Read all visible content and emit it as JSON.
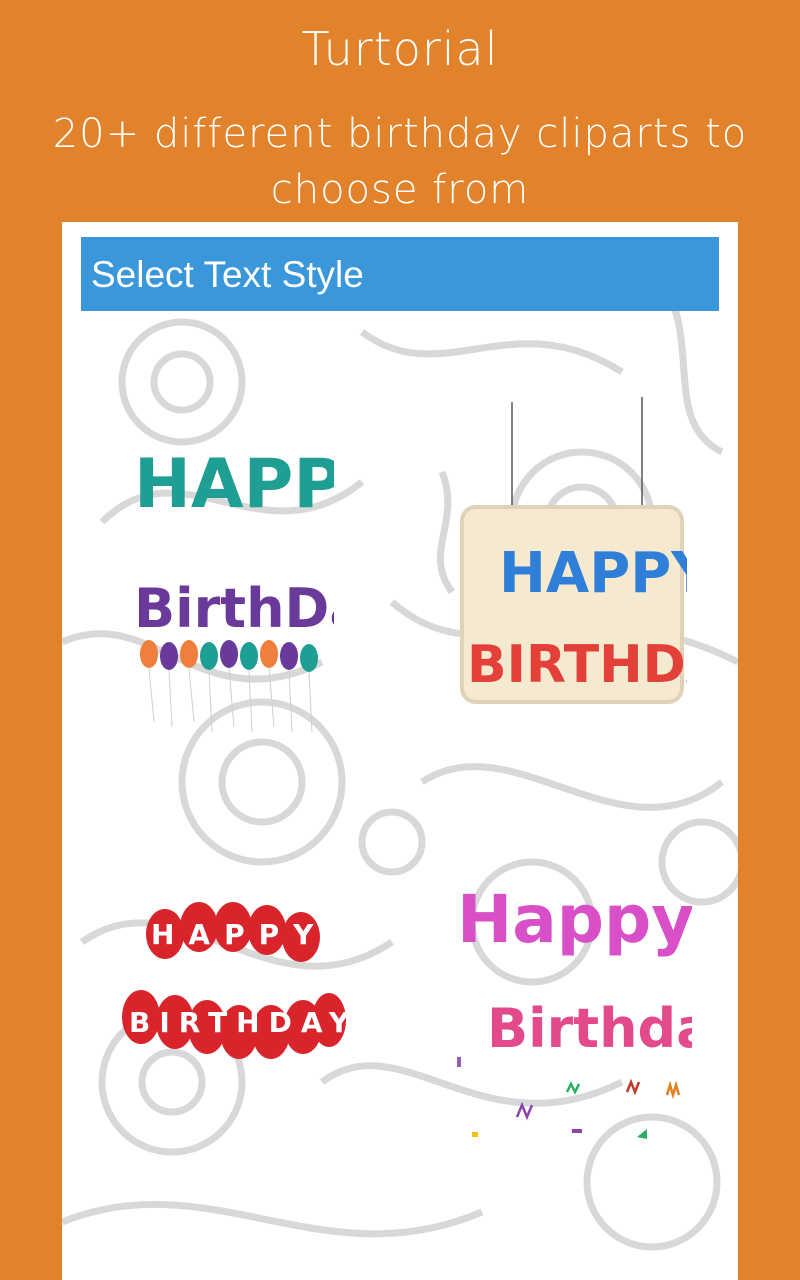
{
  "header": {
    "title": "Turtorial",
    "subtitle": "20+ different birthday cliparts  to choose from"
  },
  "dialog": {
    "title": "Select Text Style"
  },
  "cliparts": [
    {
      "line1": "HAPPY",
      "line2": "BirthDay",
      "style": "colorful-balloons"
    },
    {
      "line1": "HAPPY",
      "line2": "BIRTHDAY",
      "style": "hanging-sign"
    },
    {
      "line1": "HAPPY",
      "line2": "BIRTHDAY",
      "style": "red-balloons"
    },
    {
      "line1": "Happy",
      "line2": "Birthday",
      "style": "confetti"
    }
  ],
  "colors": {
    "background": "#E2822B",
    "dialog_header": "#3A97D9",
    "panel": "#FFFFFF",
    "pattern": "#D4D4D4"
  }
}
